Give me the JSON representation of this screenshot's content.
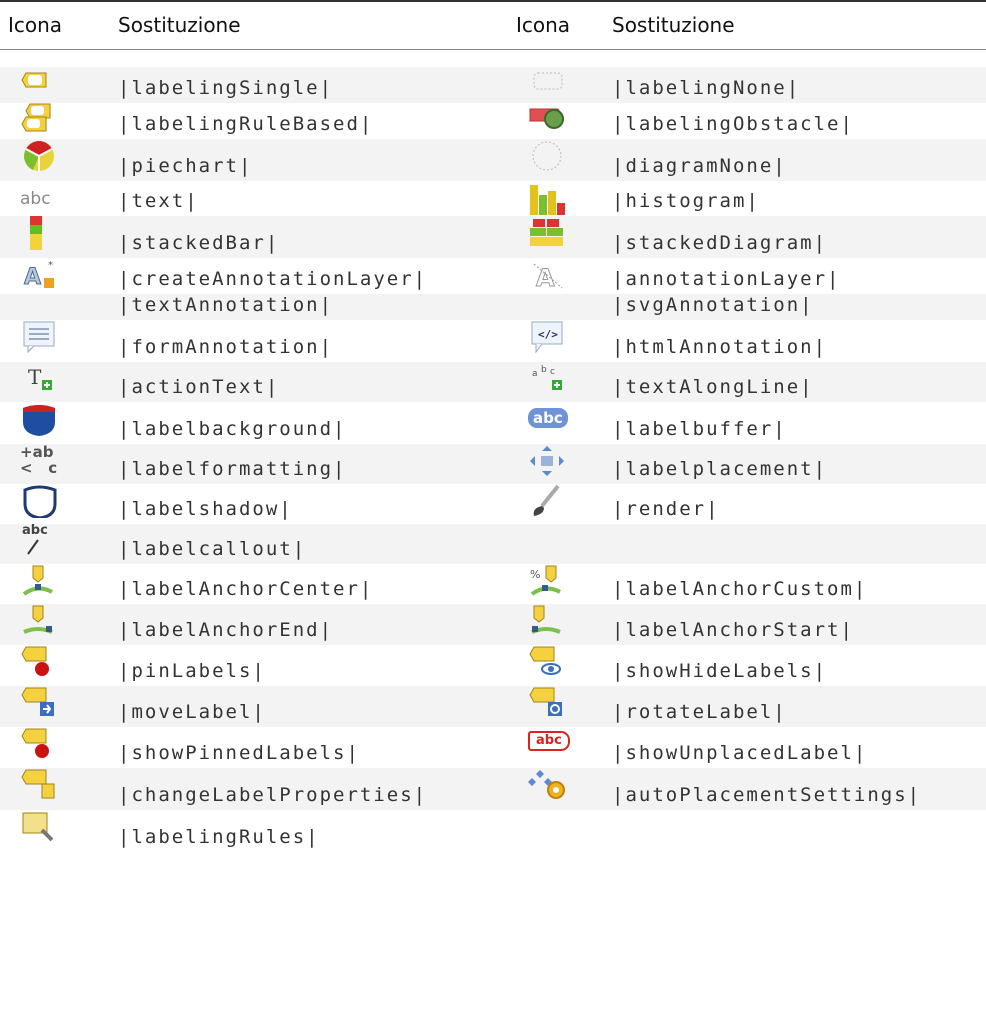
{
  "header": {
    "col1": "Icona",
    "col2": "Sostituzione",
    "col3": "Icona",
    "col4": "Sostituzione"
  },
  "rows": [
    {
      "left_icon": "labeling-single-icon",
      "left": "|labelingSingle|",
      "right_icon": "labeling-none-icon",
      "right": "|labelingNone|"
    },
    {
      "left_icon": "labeling-rule-based-icon",
      "left": "|labelingRuleBased|",
      "right_icon": "labeling-obstacle-icon",
      "right": "|labelingObstacle|"
    },
    {
      "left_icon": "piechart-icon",
      "left": "|piechart|",
      "right_icon": "diagram-none-icon",
      "right": "|diagramNone|"
    },
    {
      "left_icon": "text-icon",
      "left_icon_text": "abc",
      "left": "|text|",
      "right_icon": "histogram-icon",
      "right": "|histogram|"
    },
    {
      "left_icon": "stacked-bar-icon",
      "left": "|stackedBar|",
      "right_icon": "stacked-diagram-icon",
      "right": "|stackedDiagram|"
    },
    {
      "left_icon": "create-annotation-layer-icon",
      "left": "|createAnnotationLayer|",
      "right_icon": "annotation-layer-icon",
      "right": "|annotationLayer|"
    },
    {
      "left_icon": "",
      "left": "|textAnnotation|",
      "right_icon": "",
      "right": "|svgAnnotation|"
    },
    {
      "left_icon": "form-annotation-icon",
      "left": "|formAnnotation|",
      "right_icon": "html-annotation-icon",
      "right": "|htmlAnnotation|"
    },
    {
      "left_icon": "action-text-icon",
      "left": "|actionText|",
      "right_icon": "text-along-line-icon",
      "right": "|textAlongLine|"
    },
    {
      "left_icon": "label-background-icon",
      "left": "|labelbackground|",
      "right_icon": "label-buffer-icon",
      "right_icon_text": "abc",
      "right": "|labelbuffer|"
    },
    {
      "left_icon": "label-formatting-icon",
      "left_icon_text": "+ab < c",
      "left": "|labelformatting|",
      "right_icon": "label-placement-icon",
      "right": "|labelplacement|"
    },
    {
      "left_icon": "label-shadow-icon",
      "left": "|labelshadow|",
      "right_icon": "render-brush-icon",
      "right": "|render|"
    },
    {
      "left_icon": "label-callout-icon",
      "left_icon_text": "abc",
      "left": "|labelcallout|",
      "right_icon": "",
      "right": ""
    },
    {
      "left_icon": "label-anchor-center-icon",
      "left": "|labelAnchorCenter|",
      "right_icon": "label-anchor-custom-icon",
      "right": "|labelAnchorCustom|"
    },
    {
      "left_icon": "label-anchor-end-icon",
      "left": "|labelAnchorEnd|",
      "right_icon": "label-anchor-start-icon",
      "right": "|labelAnchorStart|"
    },
    {
      "left_icon": "pin-labels-icon",
      "left": "|pinLabels|",
      "right_icon": "show-hide-labels-icon",
      "right": "|showHideLabels|"
    },
    {
      "left_icon": "move-label-icon",
      "left": "|moveLabel|",
      "right_icon": "rotate-label-icon",
      "right": "|rotateLabel|"
    },
    {
      "left_icon": "show-pinned-labels-icon",
      "left": "|showPinnedLabels|",
      "right_icon": "show-unplaced-label-icon",
      "right_icon_text": "abc",
      "right": "|showUnplacedLabel|"
    },
    {
      "left_icon": "change-label-properties-icon",
      "left": "|changeLabelProperties|",
      "right_icon": "auto-placement-settings-icon",
      "right": "|autoPlacementSettings|"
    },
    {
      "left_icon": "labeling-rules-icon",
      "left": "|labelingRules|",
      "right_icon": "",
      "right": ""
    }
  ]
}
